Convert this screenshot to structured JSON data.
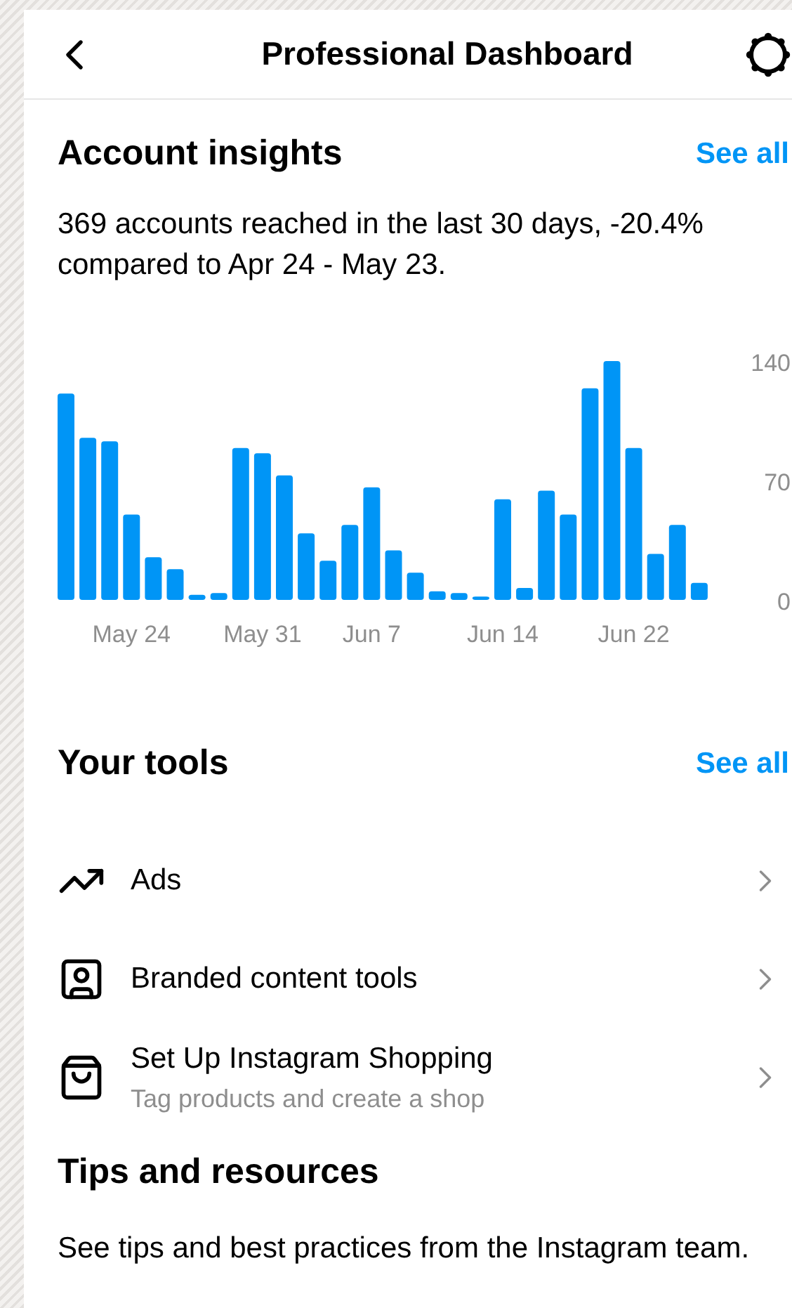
{
  "header": {
    "title": "Professional Dashboard"
  },
  "insights": {
    "title": "Account insights",
    "see_all": "See all",
    "summary": "369 accounts reached in the last 30 days, -20.4% compared to Apr 24 - May 23.",
    "chart_data": {
      "type": "bar",
      "categories": [
        null,
        null,
        null,
        "May 24",
        null,
        null,
        null,
        null,
        null,
        "May 31",
        null,
        null,
        null,
        null,
        "Jun 7",
        null,
        null,
        null,
        null,
        null,
        "Jun 14",
        null,
        null,
        null,
        null,
        null,
        "Jun 22",
        null,
        null,
        null
      ],
      "series": [
        {
          "color": "#0095f6",
          "values": [
            121,
            95,
            93,
            50,
            25,
            18,
            3,
            4,
            89,
            86,
            73,
            39,
            23,
            44,
            66,
            29,
            16,
            5,
            4,
            2,
            59,
            7,
            64,
            50,
            124,
            140,
            89,
            27,
            44,
            10
          ]
        }
      ],
      "ylim": [
        0,
        140
      ],
      "yticks": [
        {
          "value": 0,
          "label": "0"
        },
        {
          "value": 70,
          "label": "70"
        },
        {
          "value": 140,
          "label": "140"
        }
      ]
    }
  },
  "tools": {
    "title": "Your tools",
    "see_all": "See all",
    "items": [
      {
        "kind": "trend",
        "label": "Ads"
      },
      {
        "kind": "badge",
        "label": "Branded content tools"
      },
      {
        "kind": "bag",
        "label": "Set Up Instagram Shopping",
        "subtitle": "Tag products and create a shop"
      }
    ]
  },
  "tips": {
    "title": "Tips and resources",
    "text": "See tips and best practices from the Instagram team."
  }
}
